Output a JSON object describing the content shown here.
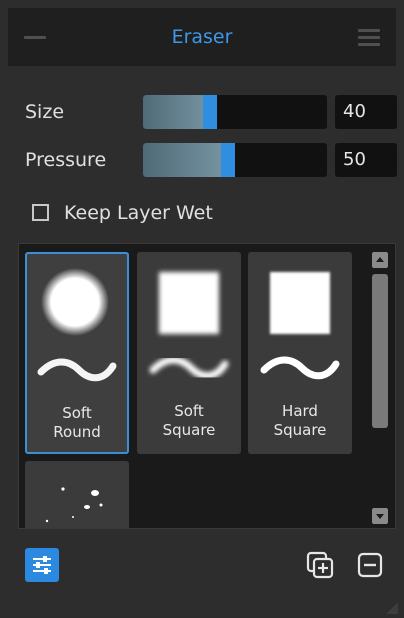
{
  "panel": {
    "title": "Eraser"
  },
  "settings": {
    "size": {
      "label": "Size",
      "value": "40",
      "fraction": 0.4
    },
    "pressure": {
      "label": "Pressure",
      "value": "50",
      "fraction": 0.5
    },
    "keep_layer_wet": {
      "label": "Keep Layer Wet",
      "checked": false
    }
  },
  "presets": [
    {
      "line1": "Soft",
      "line2": "Round",
      "selected": true,
      "icon": "soft-round-brush-icon"
    },
    {
      "line1": "Soft",
      "line2": "Square",
      "selected": false,
      "icon": "soft-square-brush-icon"
    },
    {
      "line1": "Hard",
      "line2": "Square",
      "selected": false,
      "icon": "hard-square-brush-icon"
    },
    {
      "line1": "",
      "line2": "",
      "selected": false,
      "icon": "speckle-brush-icon"
    }
  ],
  "toolbar": {
    "settings_icon": "sliders-icon",
    "duplicate_icon": "duplicate-preset-icon",
    "remove_icon": "remove-preset-icon"
  },
  "colors": {
    "accent": "#2b8ae0",
    "title": "#3f97e8",
    "background": "#2d2d2d"
  }
}
